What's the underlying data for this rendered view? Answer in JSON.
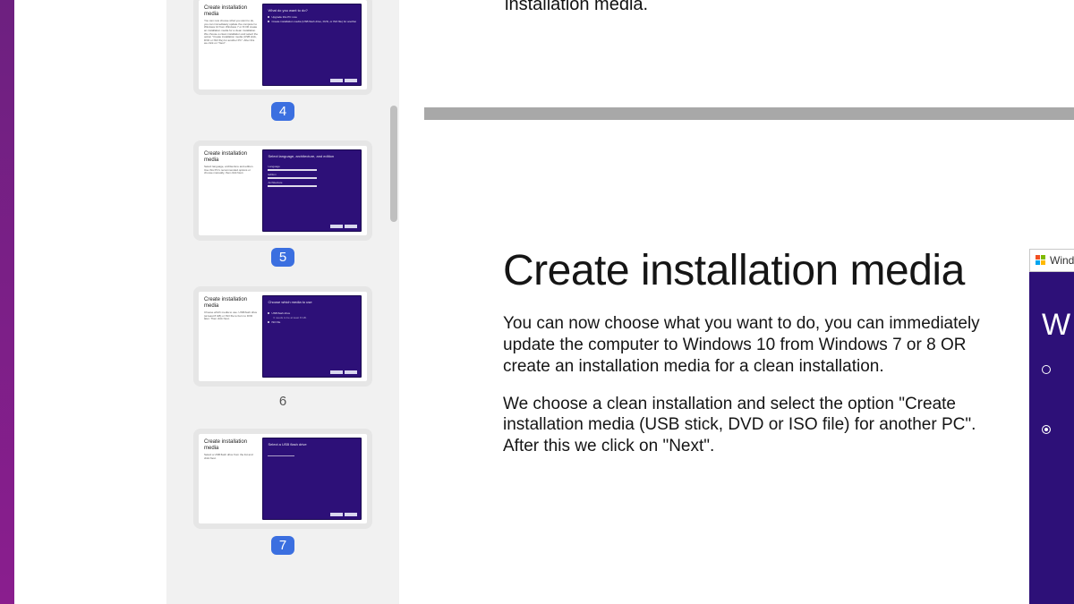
{
  "thumbnails": [
    {
      "number": "4",
      "selected": true,
      "left_title": "Create installation media",
      "left_desc": "You can now choose what you want to do, you can immediately update the computer to Windows 10 from Windows 7 or 8 OR create an installation media for a clean installation. We choose a clean installation and select the option \"Create installation media (USB stick, DVD or ISO file) for another PC\". After this we click on \"Next\".",
      "dialog_title": "What do you want to do?",
      "kind": "options2"
    },
    {
      "number": "5",
      "selected": true,
      "left_title": "Create installation media",
      "left_desc": "Select language, architecture and edition. Use this PC's recommended options or choose manually, then click Next.",
      "dialog_title": "Select language, architecture, and edition",
      "kind": "3bars"
    },
    {
      "number": "6",
      "selected": false,
      "left_title": "Create installation media",
      "left_desc": "Choose which media to use. USB flash drive (at least 8 GB) or ISO file to burn to DVD later. Then click Next.",
      "dialog_title": "Choose which media to use",
      "kind": "options2"
    },
    {
      "number": "7",
      "selected": true,
      "left_title": "Create installation media",
      "left_desc": "Select a USB flash drive from the list and click Next.",
      "dialog_title": "Select a USB flash drive",
      "kind": "1bar"
    }
  ],
  "frag_top_text": "installation media.",
  "slide": {
    "title": "Create installation media",
    "para1": "You can now choose what you want to do, you can immediately update the computer to Windows 10 from Windows 7 or 8 OR create an installation media for a clean installation.",
    "para2": "We choose a clean installation and select the option \"Create installation media (USB stick, DVD or ISO file) for another PC\". After this we click on \"Next\"."
  },
  "crop_dialog": {
    "title_fragment": "Windo",
    "big_letter": "W"
  }
}
